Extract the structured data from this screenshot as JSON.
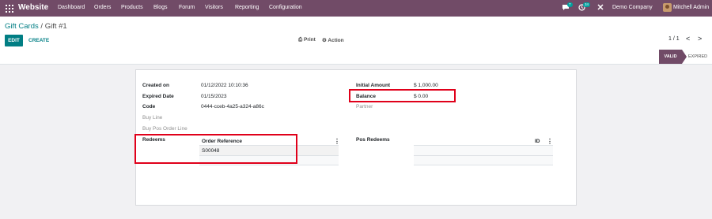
{
  "navbar": {
    "app_name": "Website",
    "menu": [
      "Dashboard",
      "Orders",
      "Products",
      "Blogs",
      "Forum",
      "Visitors",
      "Reporting",
      "Configuration"
    ],
    "messages_count": "7",
    "activities_count": "34",
    "company": "Demo Company",
    "user": "Mitchell Admin",
    "icons": {
      "apps": "apps-grid-icon",
      "messages": "chat-bubble-icon",
      "activities": "clock-icon",
      "debug": "tools-icon"
    },
    "colors": {
      "brand": "#714b67",
      "accent": "#017e84",
      "badge": "#00a09d"
    }
  },
  "breadcrumb": {
    "parent": "Gift Cards",
    "separator": "/",
    "current": "Gift #1"
  },
  "toolbar": {
    "edit": "EDIT",
    "create": "CREATE",
    "print": "Print",
    "action": "Action"
  },
  "pager": {
    "value": "1 / 1",
    "prev": "<",
    "next": ">"
  },
  "statusbar": {
    "active": "VALID",
    "inactive": "EXPIRED"
  },
  "form": {
    "created_on_label": "Created on",
    "created_on_value": "01/12/2022 10:10:36",
    "expired_date_label": "Expired Date",
    "expired_date_value": "01/15/2023",
    "code_label": "Code",
    "code_value": "0444-cceb-4a25-a324-a86c",
    "buy_line_label": "Buy Line",
    "buy_pos_label": "Buy Pos Order Line",
    "initial_amount_label": "Initial Amount",
    "initial_amount_value": "$ 1,000.00",
    "balance_label": "Balance",
    "balance_value": "$ 0.00",
    "partner_label": "Partner",
    "redeems_label": "Redeems",
    "redeems_column": "Order Reference",
    "redeems_rows": [
      "S00048"
    ],
    "pos_redeems_label": "Pos Redeems",
    "pos_redeems_column": "ID"
  }
}
